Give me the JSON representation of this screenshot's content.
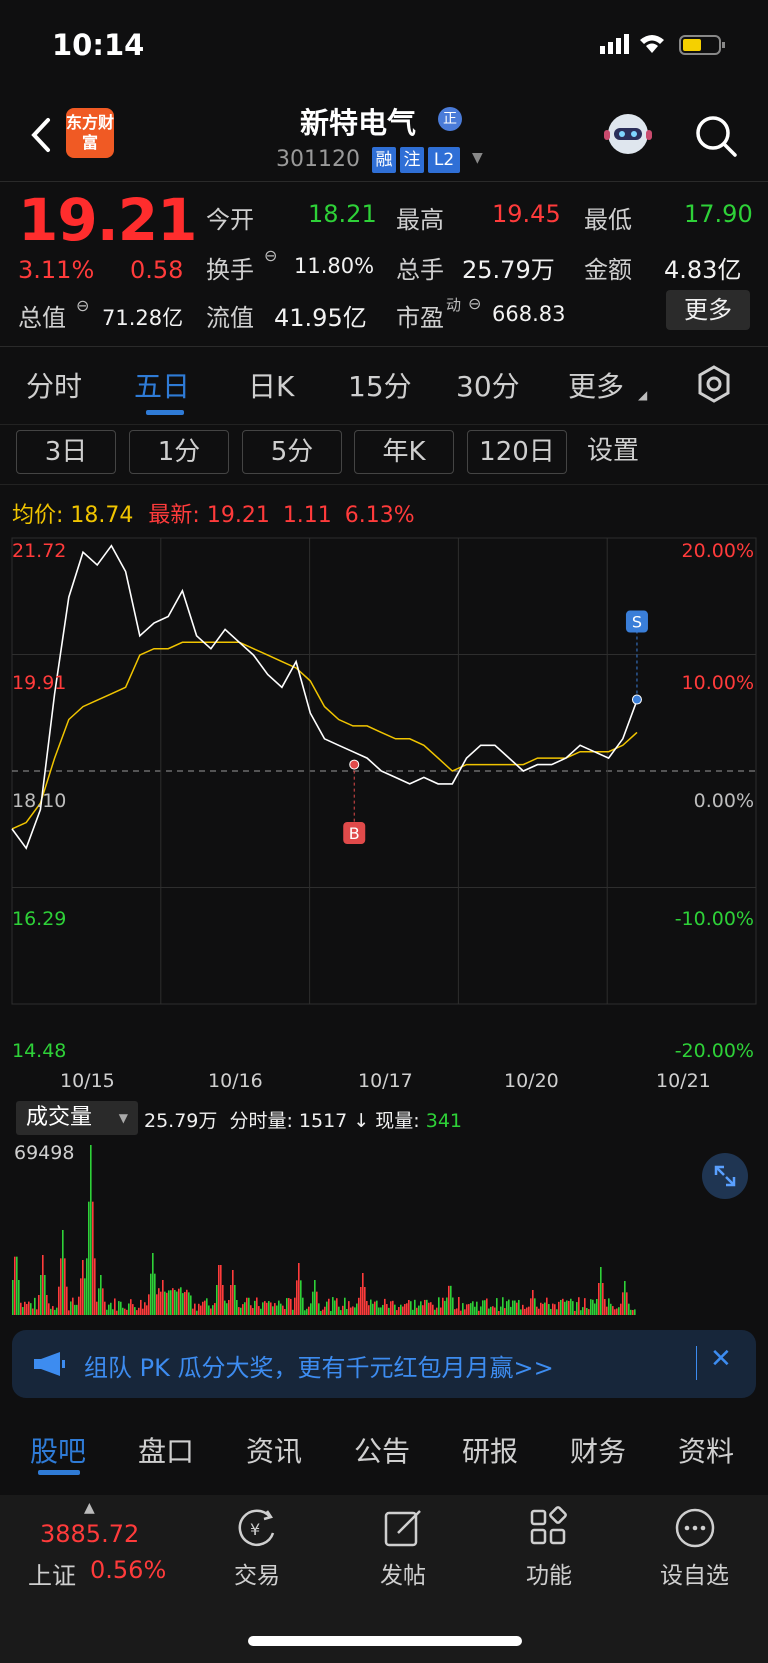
{
  "status": {
    "time": "10:14"
  },
  "header": {
    "logo": "东方财富",
    "stock_name": "新特电气",
    "badge": "正",
    "code": "301120",
    "tags": [
      "融",
      "注",
      "L2"
    ]
  },
  "quote": {
    "price": "19.21",
    "change_pct": "3.11%",
    "change": "0.58",
    "open_label": "今开",
    "open": "18.21",
    "high_label": "最高",
    "high": "19.45",
    "low_label": "最低",
    "low": "17.90",
    "turnover_label": "换手",
    "turnover": "11.80%",
    "volume_label": "总手",
    "volume": "25.79万",
    "amount_label": "金额",
    "amount": "4.83亿",
    "total_mv_label": "总值",
    "total_mv": "71.28亿",
    "float_mv_label": "流值",
    "float_mv": "41.95亿",
    "pe_label": "市盈",
    "pe_sup": "动",
    "pe": "668.83",
    "more": "更多"
  },
  "tabs": [
    "分时",
    "五日",
    "日K",
    "15分",
    "30分",
    "更多"
  ],
  "subtabs": [
    "3日",
    "1分",
    "5分",
    "年K",
    "120日",
    "设置"
  ],
  "info": {
    "avg_label": "均价:",
    "avg": "18.74",
    "latest_label": "最新:",
    "latest": "19.21",
    "latest_chg": "1.11",
    "latest_pct": "6.13%"
  },
  "chart_data": {
    "type": "line",
    "title": "",
    "price_axis": [
      "21.72",
      "19.91",
      "18.10",
      "16.29",
      "14.48"
    ],
    "pct_axis": [
      "20.00%",
      "10.00%",
      "0.00%",
      "-10.00%",
      "-20.00%"
    ],
    "dates": [
      "10/15",
      "10/16",
      "10/17",
      "10/20",
      "10/21"
    ],
    "ylim": [
      14.48,
      21.72
    ],
    "prev_close": 18.1,
    "markers": [
      {
        "label": "B",
        "price": 18.2
      },
      {
        "label": "S",
        "price": 19.21
      }
    ],
    "series": [
      {
        "values": [
          17.2,
          16.9,
          17.5,
          19.3,
          20.8,
          21.5,
          21.3,
          21.6,
          21.2,
          20.2,
          20.4,
          20.5,
          20.9,
          20.2,
          20.0,
          20.3,
          20.1,
          19.9,
          19.6,
          19.4,
          19.8,
          19.0,
          18.6,
          18.5,
          18.4,
          18.3,
          18.1,
          18.0,
          17.9,
          18.0,
          17.9,
          17.9,
          18.3,
          18.5,
          18.5,
          18.3,
          18.1,
          18.2,
          18.2,
          18.3,
          18.5,
          18.4,
          18.3,
          18.6,
          19.2
        ]
      },
      {
        "values": [
          17.2,
          17.3,
          17.6,
          18.3,
          18.9,
          19.1,
          19.2,
          19.3,
          19.4,
          19.9,
          20.0,
          20.0,
          20.1,
          20.1,
          20.1,
          20.1,
          20.1,
          20.0,
          19.9,
          19.8,
          19.7,
          19.5,
          19.1,
          18.9,
          18.8,
          18.8,
          18.7,
          18.6,
          18.6,
          18.5,
          18.3,
          18.1,
          18.2,
          18.2,
          18.2,
          18.2,
          18.2,
          18.3,
          18.3,
          18.3,
          18.4,
          18.4,
          18.4,
          18.5,
          18.7
        ]
      }
    ]
  },
  "volume": {
    "selector": "成交量",
    "total": "25.79万",
    "minute_label": "分时量:",
    "minute": "1517",
    "now_label": "现量:",
    "now": "341",
    "max": "69498"
  },
  "banner": {
    "text": "组队 PK 瓜分大奖，更有千元红包月月赢>>"
  },
  "bottom_tabs": [
    "股吧",
    "盘口",
    "资讯",
    "公告",
    "研报",
    "财务",
    "资料"
  ],
  "bottom_bar": {
    "index_value": "3885.72",
    "index_name": "上证",
    "index_pct": "0.56%",
    "items": [
      "交易",
      "发帖",
      "功能",
      "设自选"
    ]
  },
  "colors": {
    "up": "#ff3b3b",
    "down": "#2ed138",
    "avg": "#f0c400",
    "accent": "#2f7bd6"
  }
}
